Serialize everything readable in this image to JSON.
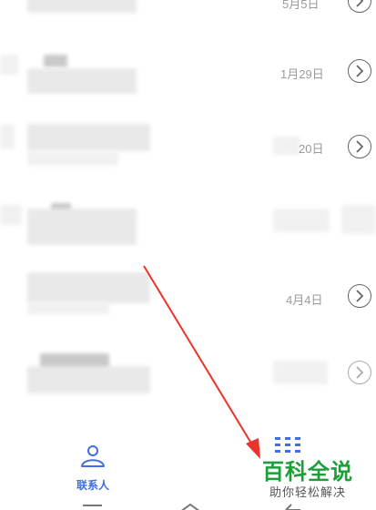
{
  "list": {
    "rows": [
      {
        "date": "5月5日"
      },
      {
        "date": "1月29日"
      },
      {
        "date": "20日"
      },
      {
        "date": ""
      },
      {
        "date": "4月4日"
      },
      {
        "date": ""
      }
    ]
  },
  "bottom_nav": {
    "contacts_label": "联系人",
    "contacts_icon": "person-icon",
    "apps_icon": "grid-dots-icon"
  },
  "watermark": {
    "title": "百科全说",
    "subtitle": "助你轻松解决"
  },
  "colors": {
    "accent_blue": "#3f6fe0",
    "arrow_red": "#e8342a",
    "watermark_green": "#1e9e3a"
  },
  "system_bar": {
    "icons": [
      "menu-icon",
      "home-icon",
      "back-icon"
    ]
  }
}
